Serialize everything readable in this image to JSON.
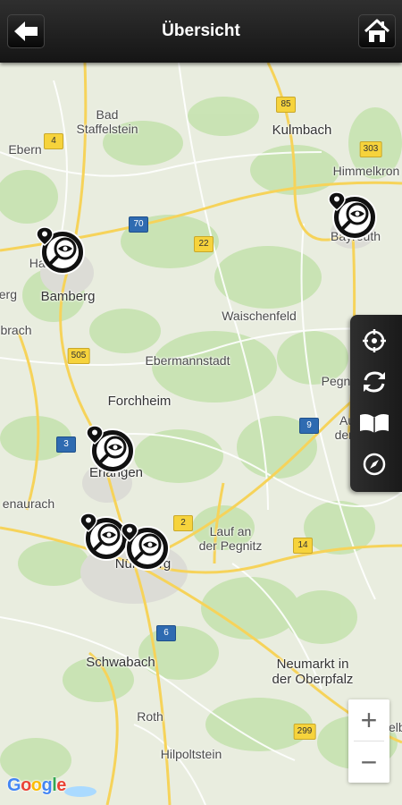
{
  "header": {
    "title": "Übersicht",
    "back_icon": "arrow-left-icon",
    "home_icon": "home-icon"
  },
  "map": {
    "places": [
      {
        "id": "bad-staffelstein",
        "lines": [
          "Bad",
          "Staffelstein"
        ]
      },
      {
        "id": "ebern",
        "lines": [
          "Ebern"
        ]
      },
      {
        "id": "kulmbach",
        "lines": [
          "Kulmbach"
        ]
      },
      {
        "id": "himmelkron",
        "lines": [
          "Himmelkron"
        ]
      },
      {
        "id": "bayreuth",
        "lines": [
          "Bayreuth"
        ]
      },
      {
        "id": "bamberg",
        "lines": [
          "Bamberg"
        ]
      },
      {
        "id": "hallstadt",
        "lines": [
          "Hallstadt"
        ]
      },
      {
        "id": "berg",
        "lines": [
          "berg"
        ]
      },
      {
        "id": "brach",
        "lines": [
          "brach"
        ]
      },
      {
        "id": "waischenfeld",
        "lines": [
          "Waischenfeld"
        ]
      },
      {
        "id": "ebermannstadt",
        "lines": [
          "Ebermannstadt"
        ]
      },
      {
        "id": "forchheim",
        "lines": [
          "Forchheim"
        ]
      },
      {
        "id": "pegnitz",
        "lines": [
          "Pegn"
        ]
      },
      {
        "id": "auerbach",
        "lines": [
          "Auerbach",
          "der Oberpf."
        ]
      },
      {
        "id": "erlangen",
        "lines": [
          "Erlangen"
        ]
      },
      {
        "id": "herzogenaurach",
        "lines": [
          "enaurach"
        ]
      },
      {
        "id": "lauf",
        "lines": [
          "Lauf an",
          "der Pegnitz"
        ]
      },
      {
        "id": "nurnberg",
        "lines": [
          "Nürnberg"
        ]
      },
      {
        "id": "schwabach",
        "lines": [
          "Schwabach"
        ]
      },
      {
        "id": "neumarkt",
        "lines": [
          "Neumarkt in",
          "der Oberpfalz"
        ]
      },
      {
        "id": "roth",
        "lines": [
          "Roth"
        ]
      },
      {
        "id": "hilpoltstein",
        "lines": [
          "Hilpoltstein"
        ]
      },
      {
        "id": "velburg",
        "lines": [
          "Velb"
        ]
      }
    ],
    "routes": [
      {
        "label": "85",
        "style": "yellow"
      },
      {
        "label": "4",
        "style": "yellow"
      },
      {
        "label": "303",
        "style": "yellow"
      },
      {
        "label": "70",
        "style": "blue"
      },
      {
        "label": "22",
        "style": "yellow"
      },
      {
        "label": "505",
        "style": "yellow"
      },
      {
        "label": "9",
        "style": "blue"
      },
      {
        "label": "3",
        "style": "blue"
      },
      {
        "label": "2",
        "style": "yellow"
      },
      {
        "label": "14",
        "style": "yellow"
      },
      {
        "label": "6",
        "style": "blue"
      },
      {
        "label": "299",
        "style": "yellow"
      }
    ],
    "markers": [
      {
        "id": "hallstadt",
        "icon": "eye-magnifier-marker-icon"
      },
      {
        "id": "bayreuth",
        "icon": "eye-magnifier-marker-icon"
      },
      {
        "id": "erlangen",
        "icon": "eye-magnifier-marker-icon"
      },
      {
        "id": "nurnberg-west",
        "icon": "eye-magnifier-marker-icon"
      },
      {
        "id": "nurnberg-east",
        "icon": "eye-magnifier-marker-icon"
      }
    ],
    "attribution": "Google"
  },
  "side_panel": {
    "buttons": [
      {
        "id": "locate",
        "icon": "crosshair-icon"
      },
      {
        "id": "refresh",
        "icon": "refresh-icon"
      },
      {
        "id": "open-book",
        "icon": "open-book-icon"
      },
      {
        "id": "compass",
        "icon": "compass-icon"
      }
    ]
  },
  "zoom": {
    "in_label": "+",
    "out_label": "−"
  },
  "colors": {
    "header": "#1c1c1c",
    "map_land": "#e9eddf",
    "map_forest": "#c8e3b4",
    "road_major": "#f7d35c",
    "motorway_shield": "#2f6bb1"
  }
}
